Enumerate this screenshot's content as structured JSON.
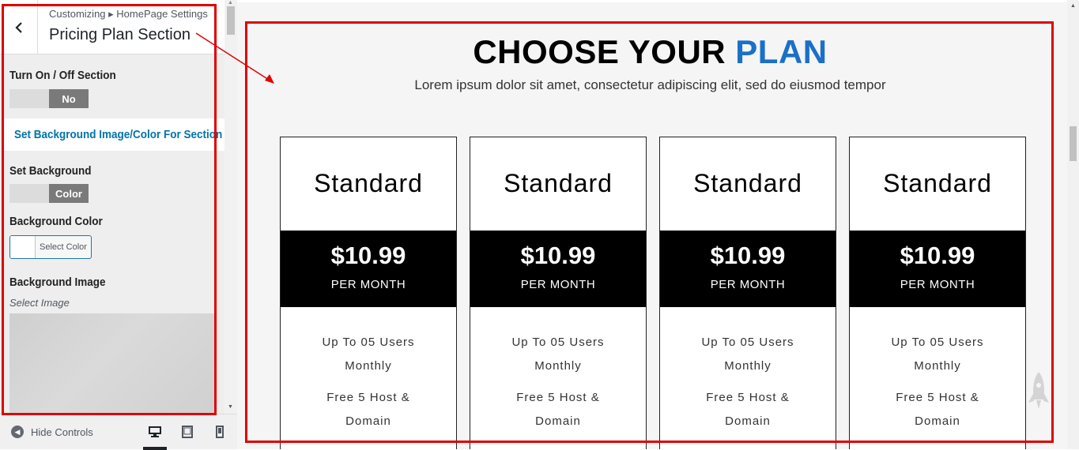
{
  "panel": {
    "breadcrumb": "Customizing ▸ HomePage Settings",
    "title": "Pricing Plan Section",
    "controls": {
      "toggle_label": "Turn On / Off Section",
      "toggle_value": "No",
      "section_link": "Set Background Image/Color For Section",
      "bg_label": "Set Background",
      "bg_value": "Color",
      "bg_color_label": "Background Color",
      "select_color": "Select Color",
      "bg_image_label": "Background Image",
      "select_image": "Select Image"
    },
    "footer": {
      "hide_controls": "Hide Controls",
      "devices": [
        "desktop",
        "tablet",
        "mobile"
      ],
      "active_device": "desktop"
    }
  },
  "preview": {
    "heading_main": "CHOOSE YOUR ",
    "heading_accent": "PLAN",
    "subheading": "Lorem ipsum dolor sit amet, consectetur adipiscing elit, sed do eiusmod tempor",
    "plans": [
      {
        "name": "Standard",
        "price": "$10.99",
        "period": "PER MONTH",
        "features": [
          "Up To 05 Users",
          "Monthly",
          "Free 5 Host &",
          "Domain"
        ]
      },
      {
        "name": "Standard",
        "price": "$10.99",
        "period": "PER MONTH",
        "features": [
          "Up To 05 Users",
          "Monthly",
          "Free 5 Host &",
          "Domain"
        ]
      },
      {
        "name": "Standard",
        "price": "$10.99",
        "period": "PER MONTH",
        "features": [
          "Up To 05 Users",
          "Monthly",
          "Free 5 Host &",
          "Domain"
        ]
      },
      {
        "name": "Standard",
        "price": "$10.99",
        "period": "PER MONTH",
        "features": [
          "Up To 05 Users",
          "Monthly",
          "Free 5 Host &",
          "Domain"
        ]
      }
    ]
  },
  "colors": {
    "accent": "#1a70c8",
    "link": "#0073aa",
    "highlight": "#e00000",
    "price_band": "#000000"
  }
}
